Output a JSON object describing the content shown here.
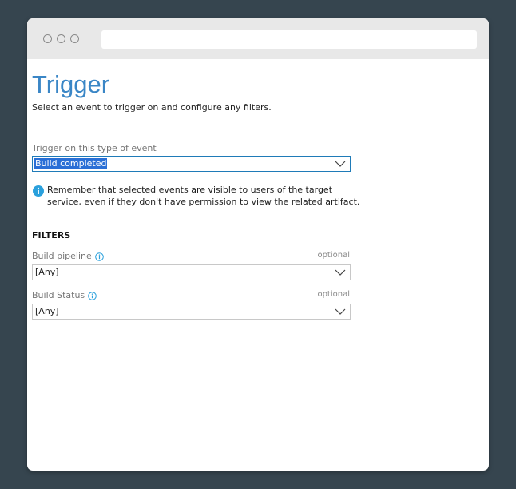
{
  "page": {
    "title": "Trigger",
    "subtitle": "Select an event to trigger on and configure any filters."
  },
  "event": {
    "label": "Trigger on this type of event",
    "value": "Build completed"
  },
  "notice": {
    "text": "Remember that selected events are visible to users of the target service, even if they don't have permission to view the related artifact."
  },
  "filters": {
    "heading": "FILTERS",
    "pipeline": {
      "label": "Build pipeline",
      "optional": "optional",
      "value": "[Any]"
    },
    "status": {
      "label": "Build Status",
      "optional": "optional",
      "value": "[Any]"
    }
  },
  "colors": {
    "title": "#3a86c6",
    "focus_border": "#1f7bb8",
    "selection": "#2a6fd6",
    "info_icon": "#2aa0dc",
    "background": "#36454f"
  },
  "icons": {
    "browser_dots": "window-control-dots-icon",
    "dropdown": "chevron-down-icon",
    "info": "info-icon"
  }
}
